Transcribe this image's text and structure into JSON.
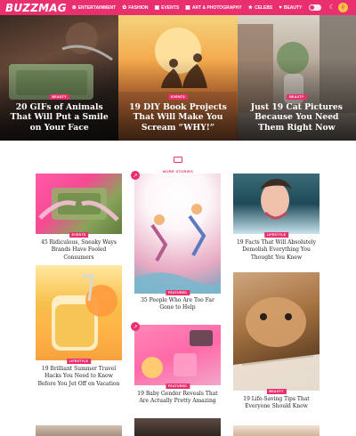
{
  "brand": {
    "name": "BUZZMAG",
    "accent": "#ea2f6f"
  },
  "nav": [
    {
      "icon": "globe-icon",
      "glyph": "⊕",
      "label": "Entertainment"
    },
    {
      "icon": "camera-icon",
      "glyph": "✿",
      "label": "Fashion"
    },
    {
      "icon": "calendar-icon",
      "glyph": "▣",
      "label": "Events"
    },
    {
      "icon": "image-icon",
      "glyph": "▦",
      "label": "Art & Photography"
    },
    {
      "icon": "star-icon",
      "glyph": "★",
      "label": "Celebs"
    },
    {
      "icon": "heart-icon",
      "glyph": "♥",
      "label": "Beauty"
    }
  ],
  "hero": [
    {
      "badge": "BEAUTY",
      "title": "20 GIFs of Animals That Will Put a Smile on Your Face"
    },
    {
      "badge": "EVENTS",
      "title": "19 DIY Book Projects That Will Make You Scream “WHY!”"
    },
    {
      "badge": "BEAUTY",
      "title": "Just 19 Cat Pictures Because You Need Them Right Now"
    }
  ],
  "more": {
    "label": "MORE STORIES"
  },
  "cards": [
    {
      "badge": "EVENTS",
      "title": "45 Ridiculous, Sneaky Ways Brands Have Fooled Consumers"
    },
    {
      "badge": "FEATURED",
      "title": "35 People Who Are Too Far Gone to Help"
    },
    {
      "badge": "LIFESTYLE",
      "title": "19 Facts That Will Absolutely Demolish Everything You Thought You Knew"
    },
    {
      "badge": "LIFESTYLE",
      "title": "19 Brilliant Summer Travel Hacks You Need to Know Before You Jet Off on Vacation"
    },
    {
      "badge": "FEATURED",
      "title": "19 Baby Gender Reveals That Are Actually Pretty Amazing"
    },
    {
      "badge": "BEAUTY",
      "title": "19 Life-Saving Tips That Everyone Should Know"
    }
  ]
}
